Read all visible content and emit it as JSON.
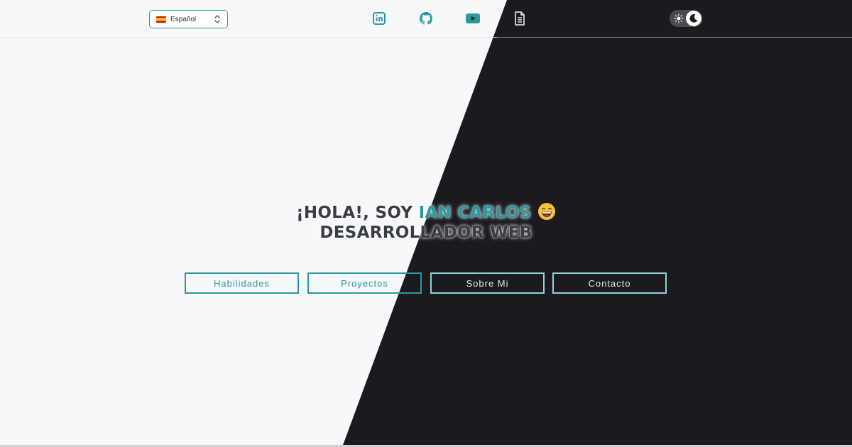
{
  "header": {
    "language": {
      "selected": "Español",
      "flag_icon": "spain-flag-icon"
    },
    "social_links": [
      {
        "name": "linkedin",
        "icon": "linkedin-icon"
      },
      {
        "name": "github",
        "icon": "github-icon"
      },
      {
        "name": "youtube",
        "icon": "youtube-icon"
      },
      {
        "name": "resume",
        "icon": "document-icon"
      }
    ],
    "theme_toggle": {
      "icons": [
        "sun-icon",
        "moon-icon"
      ],
      "mode": "dark"
    }
  },
  "hero": {
    "greeting_prefix": "¡HOLA!, SOY ",
    "name": "IAN CARLOS",
    "emoji": "grinning-face-emoji",
    "role": "DESARROLLADOR WEB"
  },
  "nav": {
    "skills": "Habilidades",
    "projects": "Proyectos",
    "about": "Sobre Mi",
    "contact": "Contacto"
  },
  "colors": {
    "accent": "#2a9aa1",
    "light_bg": "#f7f8fa",
    "dark_bg": "#1b1a1f"
  }
}
